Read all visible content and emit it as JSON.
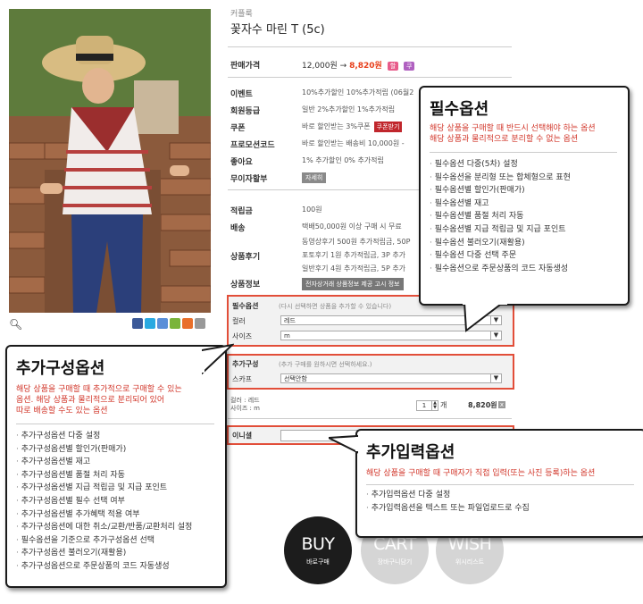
{
  "product": {
    "breadcrumb": "커플룩",
    "title": "꽃자수 마린 T (5c)",
    "price_label": "판매가격",
    "price_original": "12,000원",
    "price_arrow": "→",
    "price_sale": "8,820원",
    "badge1": "할",
    "badge2": "쿠",
    "rows": [
      {
        "label": "이벤트",
        "value": "10%추가할인 10%추가적립 (06월2"
      },
      {
        "label": "회원등급",
        "value": "일반 2%추가할인 1%추가적립"
      },
      {
        "label": "쿠폰",
        "value": "바로 할인받는 3%쿠폰"
      },
      {
        "label": "프로모션코드",
        "value": "바로 할인받는 배송비 10,000원 -"
      },
      {
        "label": "좋아요",
        "value": "1% 추가할인 0% 추가적립"
      },
      {
        "label": "무이자할부",
        "value": "자세히"
      },
      {
        "label": "적립금",
        "value": "100원"
      },
      {
        "label": "배송",
        "value": "택배50,000원 이상 구매 시 무료"
      },
      {
        "label": "상품후기",
        "value": "동영상후기 500원 추가적립금, 50P"
      },
      {
        "label": "상품정보",
        "value": "전자상거래 상품정보 제공 고시 정보"
      }
    ],
    "coupon_button": "쿠폰받기",
    "review_lines": [
      "포토후기 1원 추가적립금, 3P 추가",
      "일반후기 4원 추가적립금, 5P 추가"
    ]
  },
  "required_option": {
    "heading": "필수옵션",
    "heading_note": "(다시 선택하면 상품을 추가할 수 있습니다)",
    "rows": [
      {
        "label": "컬러",
        "value": "레드"
      },
      {
        "label": "사이즈",
        "value": "m"
      }
    ]
  },
  "additional_option": {
    "heading": "추가구성",
    "heading_note": "(추가 구매를 원하시면 선택하세요.)",
    "rows": [
      {
        "label": "스카프",
        "value": "선택안함"
      }
    ]
  },
  "summary": {
    "line1": "컬러 : 레드",
    "line2": "사이즈 : m",
    "qty": "1",
    "unit": "개",
    "price": "8,820원",
    "remove": "x"
  },
  "input_option": {
    "label": "이니셜"
  },
  "buttons": {
    "buy": {
      "big": "BUY",
      "small": "바로구매"
    },
    "cart": {
      "big": "CART",
      "small": "장바구니담기"
    },
    "wish": {
      "big": "WISH",
      "small": "위시리스트"
    }
  },
  "callout_required": {
    "title": "필수옵션",
    "desc1": "해당 상품을 구매할 때 반드시 선택해야 하는 옵션",
    "desc2": "해당 상품과 물리적으로 분리할 수 없는 옵션",
    "items": [
      "필수옵션 다중(5차) 설정",
      "필수옵션을 분리형 또는 합체형으로 표현",
      "필수옵션별 할인가(판매가)",
      "필수옵션별 재고",
      "필수옵션별 품절 처리 자동",
      "필수옵션별 지급 적립금 및 지급 포인트",
      "필수옵션 불러오기(재활용)",
      "필수옵션 다중 선택 주문",
      "필수옵션으로 주문상품의 코드 자동생성"
    ]
  },
  "callout_additional": {
    "title": "추가구성옵션",
    "desc1": "해당 상품을 구매할 때 추가적으로 구매할 수 있는",
    "desc2": "옵션. 해당 상품과 물리적으로 분리되어 있어",
    "desc3": "따로 배송할 수도 있는 옵션",
    "items": [
      "추가구성옵션 다중 설정",
      "추가구성옵션별 할인가(판매가)",
      "추가구성옵션별 재고",
      "추가구성옵션별 품절 처리 자동",
      "추가구성옵션별 지급 적립금 및 지급 포인트",
      "추가구성옵션별 필수 선택 여부",
      "추가구성옵션별 추가혜택 적용 여부",
      "추가구성옵션에 대한 취소/교환/반품/교환처리 설정",
      "필수옵션을 기준으로 추가구성옵션 선택",
      "추가구성옵션 불러오기(재활용)",
      "추가구성옵션으로 주문상품의 코드 자동생성"
    ]
  },
  "callout_input": {
    "title": "추가입력옵션",
    "desc1": "해당 상품을 구매할 때 구매자가 직접 입력(또는 사진 등록)하는 옵션",
    "items": [
      "추가입력옵션 다중 설정",
      "추가입력옵션을 텍스트 또는 파일업로드로 수집"
    ]
  }
}
